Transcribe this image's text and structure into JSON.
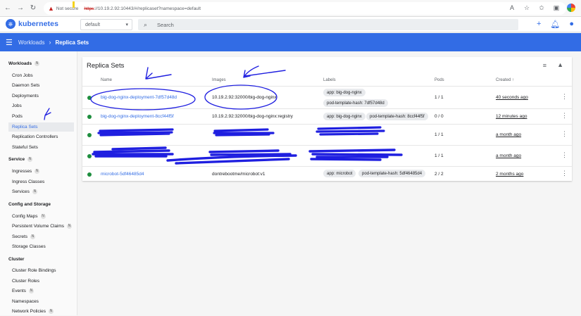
{
  "browser": {
    "not_secure": "Not secure",
    "url_scheme": "https",
    "url_rest": "://10.19.2.92:10443/#/replicaset?namespace=default"
  },
  "header": {
    "app_name": "kubernetes",
    "namespace": "default",
    "search_placeholder": "Search"
  },
  "toolbar": {
    "crumb_parent": "Workloads",
    "crumb_current": "Replica Sets"
  },
  "sidebar": {
    "workloads": {
      "label": "Workloads",
      "badge": "N",
      "items": [
        "Cron Jobs",
        "Daemon Sets",
        "Deployments",
        "Jobs",
        "Pods",
        "Replica Sets",
        "Replication Controllers",
        "Stateful Sets"
      ]
    },
    "service": {
      "label": "Service",
      "badge": "N",
      "items": [
        "Ingresses",
        "Ingress Classes",
        "Services"
      ]
    },
    "config": {
      "label": "Config and Storage",
      "items": [
        "Config Maps",
        "Persistent Volume Claims",
        "Secrets",
        "Storage Classes"
      ]
    },
    "cluster": {
      "label": "Cluster",
      "items": [
        "Cluster Role Bindings",
        "Cluster Roles",
        "Events",
        "Namespaces",
        "Network Policies"
      ]
    },
    "item_badges": {
      "ingresses": "N",
      "services": "N",
      "config_maps": "N",
      "pvc": "N",
      "secrets": "N",
      "events": "N",
      "network_policies": "N"
    }
  },
  "card": {
    "title": "Replica Sets",
    "columns": {
      "name": "Name",
      "images": "Images",
      "labels": "Labels",
      "pods": "Pods",
      "created": "Created"
    },
    "rows": [
      {
        "name": "big-dog-nginx-deployment-7df57d48d",
        "image": "10.19.2.92:32000/big-dog-nginx",
        "labels": [
          "app: big-dog-nginx",
          "pod-template-hash: 7df57d48d"
        ],
        "pods": "1 / 1",
        "created": "40 seconds ago"
      },
      {
        "name": "big-dog-nginx-deployment-8ccf44f5f",
        "image": "10.19.2.92:32000/big-dog-nginx:registry",
        "labels": [
          "app: big-dog-nginx",
          "pod-template-hash: 8ccf44f5f"
        ],
        "pods": "0 / 0",
        "created": "12 minutes ago"
      },
      {
        "name": "",
        "image": "",
        "labels": [],
        "pods": "1 / 1",
        "created": "a month ago"
      },
      {
        "name": "",
        "image": "",
        "labels": [],
        "pods": "1 / 1",
        "created": "a month ago"
      },
      {
        "name": "microbot-5df46485d4",
        "image": "dontrebootme/microbot:v1",
        "labels": [
          "app: microbot",
          "pod-template-hash: 5df46485d4"
        ],
        "pods": "2 / 2",
        "created": "2 months ago"
      }
    ]
  },
  "colors": {
    "brand": "#326ce5",
    "status_ok": "#1e8e3e",
    "scribble": "#1f1fe0"
  }
}
